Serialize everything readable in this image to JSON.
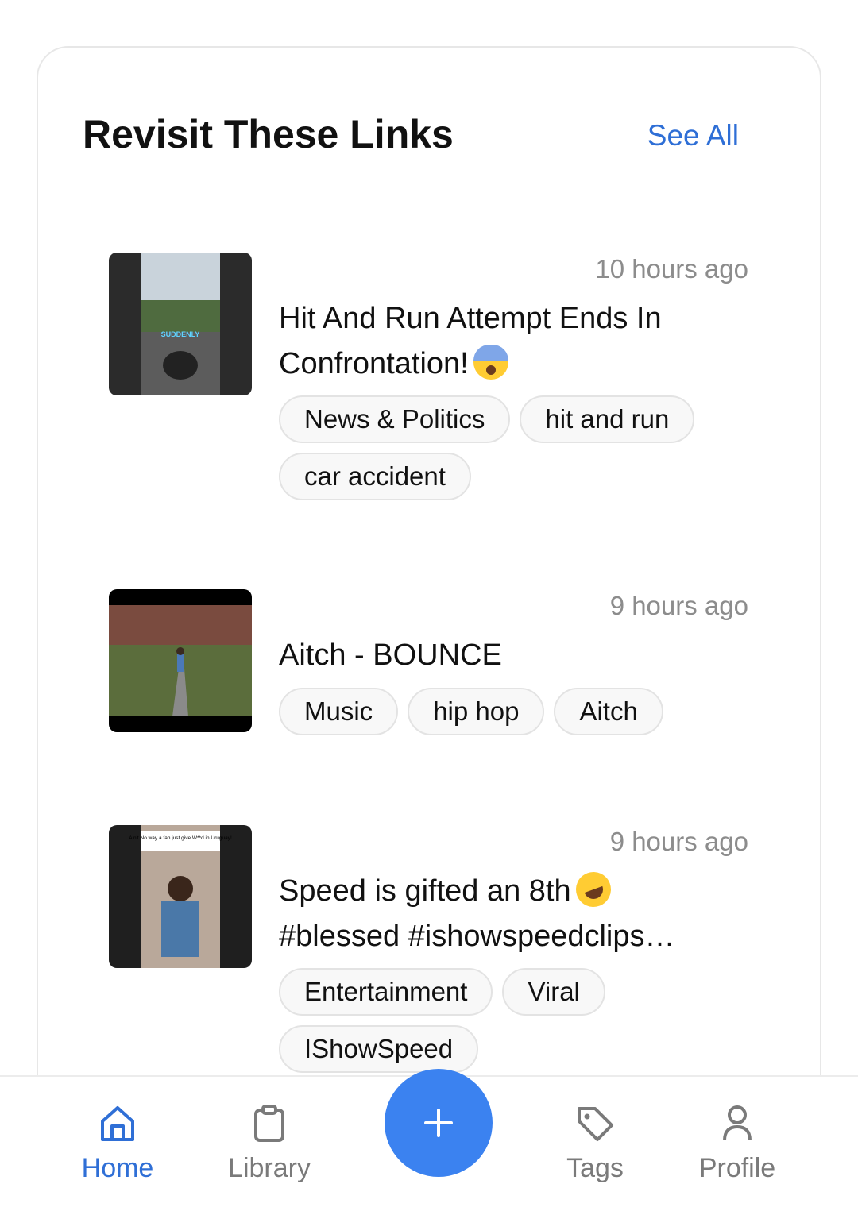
{
  "section": {
    "title": "Revisit These Links",
    "see_all": "See All"
  },
  "items": [
    {
      "time": "10 hours ago",
      "title": "Hit And Run Attempt Ends In Confrontation!",
      "emoji": "fearful-face-emoji",
      "thumb_text": "SUDDENLY",
      "tags": [
        "News & Politics",
        "hit and run",
        "car accident"
      ]
    },
    {
      "time": "9 hours ago",
      "title": "Aitch - BOUNCE",
      "tags": [
        "Music",
        "hip hop",
        "Aitch"
      ]
    },
    {
      "time": "9 hours ago",
      "title": "Speed is gifted an 8th",
      "title_line2": "#blessed #ishowspeedclips…",
      "emoji": "rolling-laughing-emoji",
      "thumb_text": "Ain't No way a fan just give W**d in Uruguay!",
      "tags": [
        "Entertainment",
        "Viral",
        "IShowSpeed"
      ]
    }
  ],
  "nav": {
    "home": "Home",
    "library": "Library",
    "tags": "Tags",
    "profile": "Profile",
    "add_icon": "plus-icon"
  },
  "colors": {
    "accent": "#2f6fd6",
    "fab": "#3b82f0",
    "muted": "#8c8c8c"
  }
}
